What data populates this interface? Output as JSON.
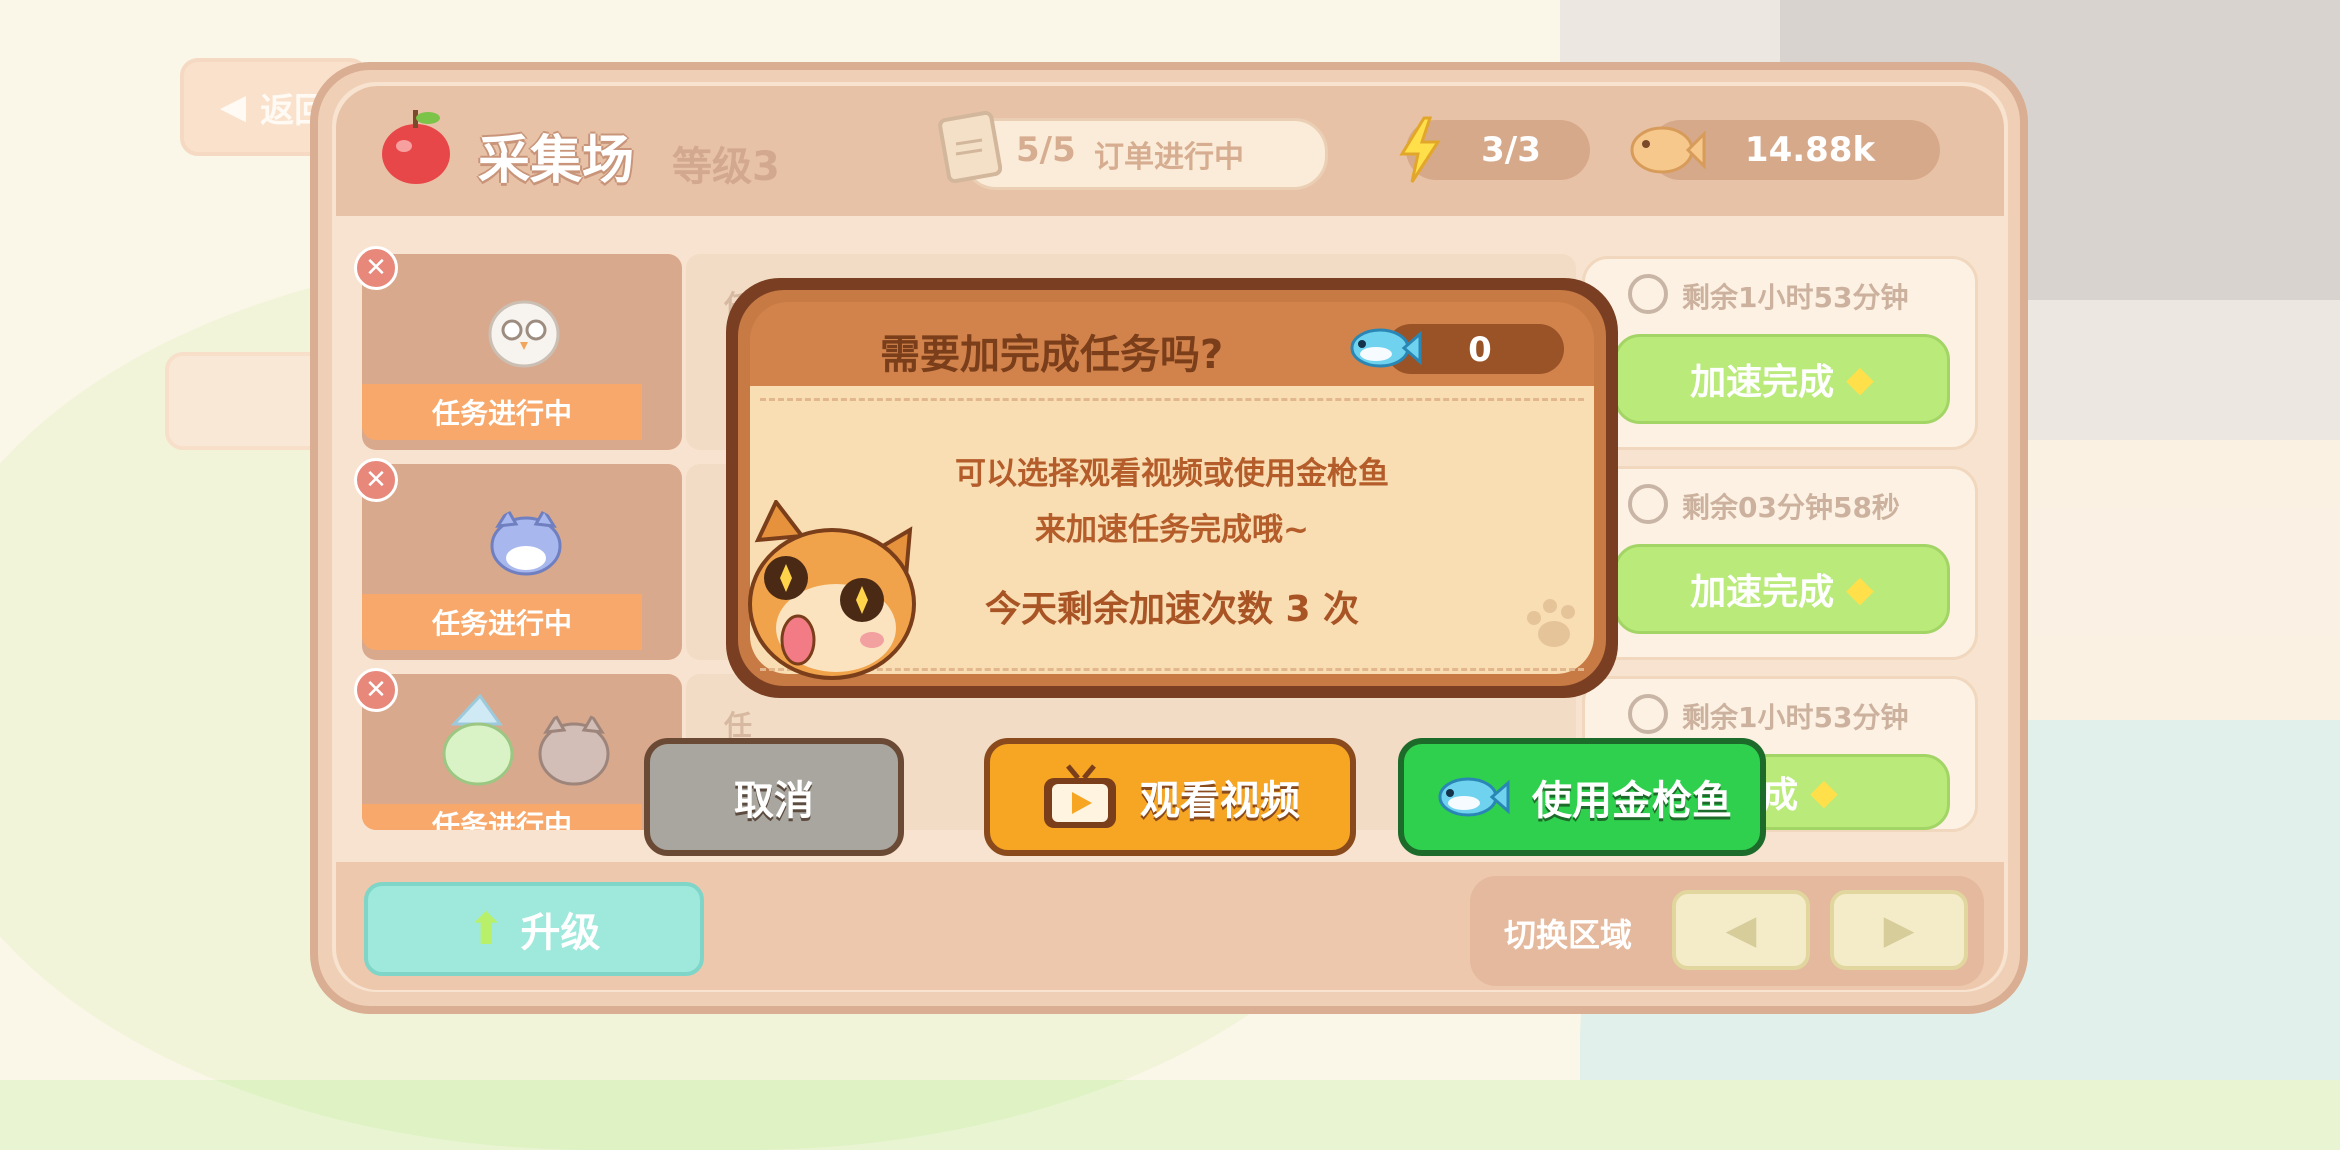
{
  "background": {
    "back_label": "返回"
  },
  "header": {
    "title": "采集场",
    "level": "等级3",
    "orders": {
      "count": "5/5",
      "label": "订单进行中"
    },
    "energy": "3/3",
    "fish_currency": "14.88k"
  },
  "tasks": [
    {
      "status": "任务进行中",
      "timer": "剩余1小时53分钟",
      "speed_label": "加速完成",
      "mid_label": "任"
    },
    {
      "status": "任务进行中",
      "timer": "剩余03分钟58秒",
      "speed_label": "加速完成",
      "mid_label": ""
    },
    {
      "status": "任务进行中",
      "timer": "剩余1小时53分钟",
      "speed_label": "完成",
      "mid_label": "任"
    }
  ],
  "bottom": {
    "upgrade_label": "升级",
    "switch_label": "切换区域"
  },
  "dialog": {
    "title": "需要加完成任务吗?",
    "fish_count": "0",
    "line1": "可以选择观看视频或使用金枪鱼",
    "line2": "来加速任务完成哦~",
    "line3": "今天剩余加速次数 3 次"
  },
  "buttons": {
    "cancel": "取消",
    "watch_video": "观看视频",
    "use_tuna": "使用金枪鱼"
  },
  "colors": {
    "panel": "#efcfb5",
    "dialog_header": "#d2834c",
    "video_button": "#f6a623",
    "tuna_button": "#2ed04e",
    "speed_button": "#b9ea7a"
  }
}
